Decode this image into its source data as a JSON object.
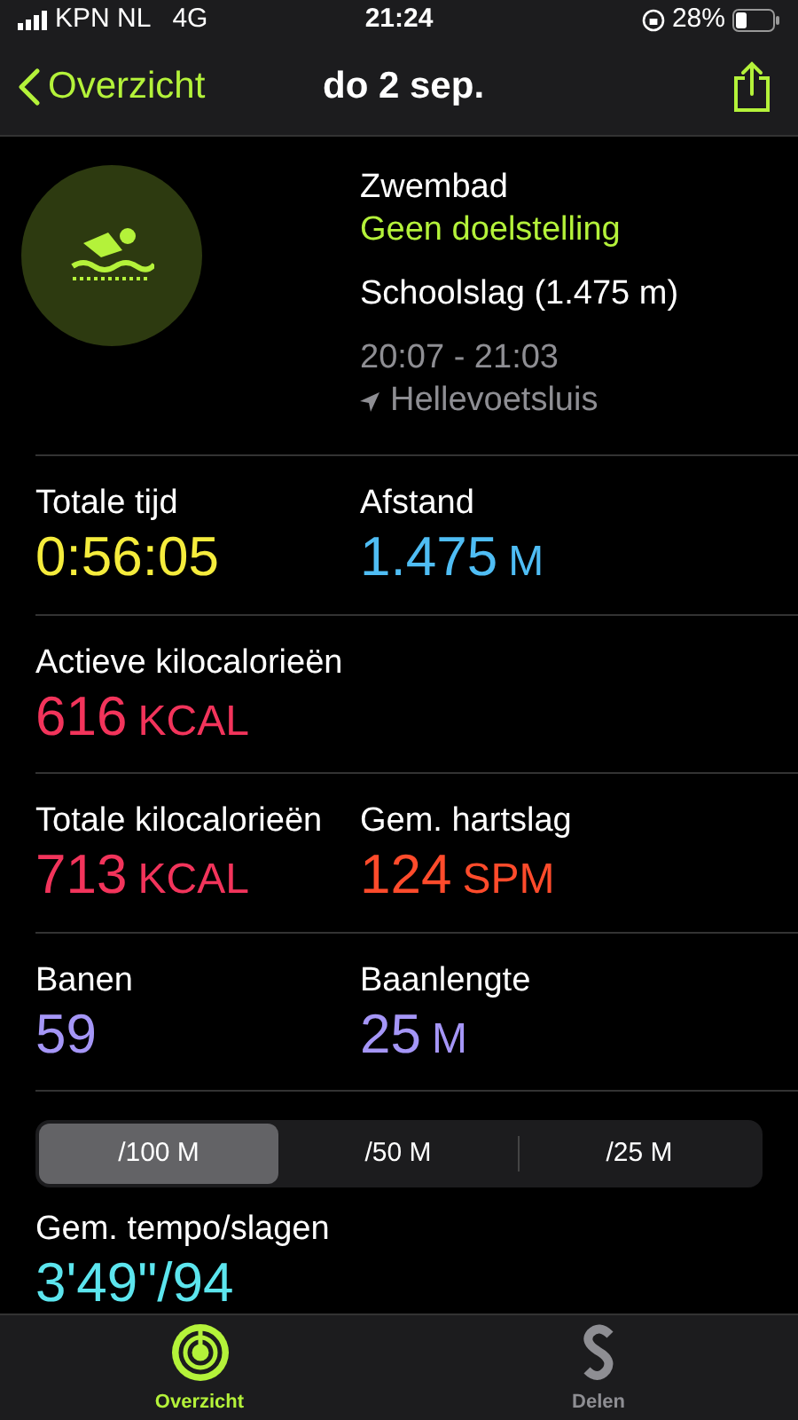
{
  "status_bar": {
    "carrier": "KPN NL",
    "network": "4G",
    "time": "21:24",
    "battery": "28%"
  },
  "nav": {
    "back": "Overzicht",
    "title": "do 2 sep."
  },
  "workout": {
    "type": "Zwembad",
    "goal": "Geen doelstelling",
    "stroke": "Schoolslag (1.475 m)",
    "time_range": "20:07 - 21:03",
    "location": "Hellevoetsluis"
  },
  "rows": [
    {
      "metrics": [
        {
          "label": "Totale tijd",
          "value": "0:56:05",
          "color": "#f5ec3c"
        },
        {
          "label": "Afstand",
          "value": "1.475",
          "unit": "M",
          "color": "#4fbdf4"
        }
      ]
    },
    {
      "metrics": [
        {
          "label": "Actieve kilocalorieën",
          "value": "616",
          "unit": "KCAL",
          "color": "#f2345b"
        }
      ]
    },
    {
      "metrics": [
        {
          "label": "Totale kilocalorieën",
          "value": "713",
          "unit": "KCAL",
          "color": "#f2345b"
        },
        {
          "label": "Gem. hartslag",
          "value": "124",
          "unit": "SPM",
          "color": "#ff4b2b"
        }
      ]
    },
    {
      "metrics": [
        {
          "label": "Banen",
          "value": "59",
          "color": "#a596f7"
        },
        {
          "label": "Baanlengte",
          "value": "25",
          "unit": "M",
          "color": "#a596f7"
        }
      ]
    }
  ],
  "segments": [
    {
      "label": "/100 M",
      "selected": true
    },
    {
      "label": "/50 M",
      "selected": false
    },
    {
      "label": "/25 M",
      "selected": false
    }
  ],
  "pace": {
    "label": "Gem. tempo/slagen",
    "value": "3'49\"/94",
    "color": "#5ce5ee"
  },
  "tab_bar": [
    {
      "label": "Overzicht",
      "selected": true
    },
    {
      "label": "Delen",
      "selected": false
    }
  ]
}
